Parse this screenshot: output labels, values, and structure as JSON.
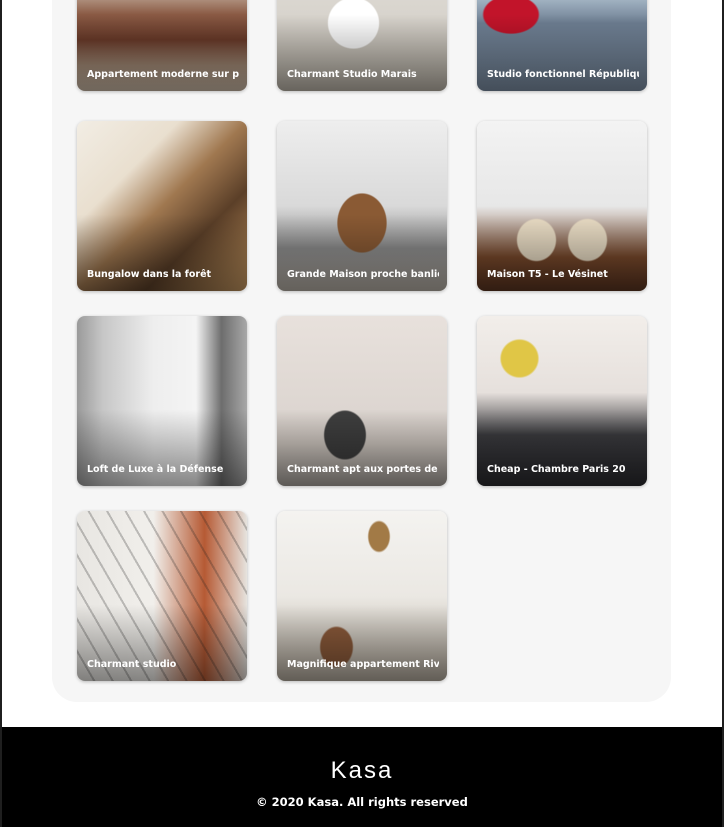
{
  "gallery": {
    "cards": [
      {
        "title": "Appartement moderne sur parc"
      },
      {
        "title": "Charmant Studio Marais"
      },
      {
        "title": "Studio fonctionnel République"
      },
      {
        "title": "Bungalow dans la forêt"
      },
      {
        "title": "Grande Maison proche banlieue"
      },
      {
        "title": "Maison T5 - Le Vésinet"
      },
      {
        "title": "Loft de Luxe à la Défense"
      },
      {
        "title": "Charmant apt aux portes de Paris"
      },
      {
        "title": "Cheap - Chambre Paris 20"
      },
      {
        "title": "Charmant studio"
      },
      {
        "title": "Magnifique appartement Rivoli"
      }
    ]
  },
  "footer": {
    "logo_text": "Kasa",
    "copyright": "© 2020 Kasa. All rights reserved"
  },
  "colors": {
    "accent": "#ff6060",
    "gallery_bg": "#f6f6f6",
    "footer_bg": "#000000"
  }
}
